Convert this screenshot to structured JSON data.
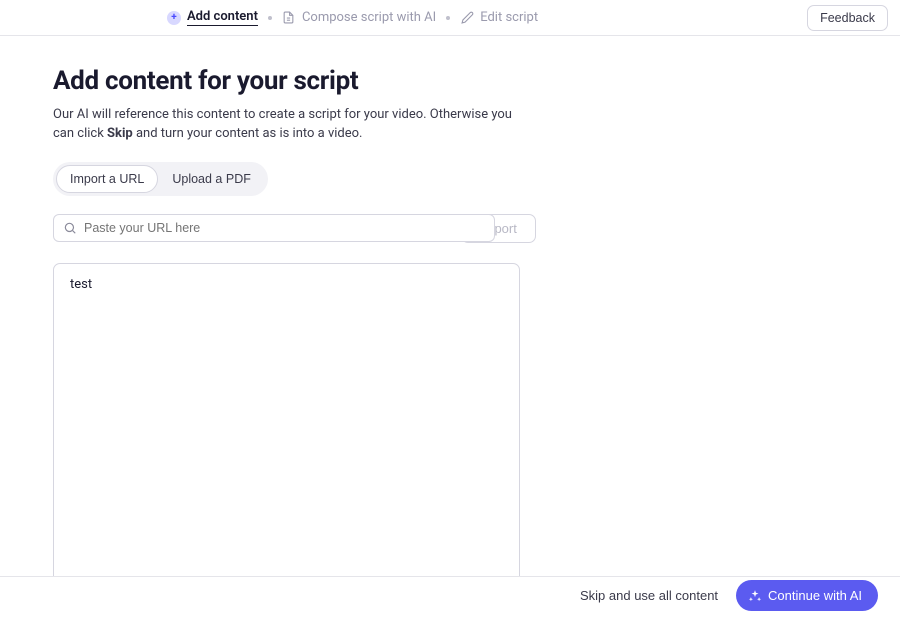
{
  "topbar": {
    "steps": {
      "add": "Add content",
      "compose": "Compose script with AI",
      "edit": "Edit script"
    },
    "feedback": "Feedback"
  },
  "main": {
    "heading": "Add content for your script",
    "desc_before": "Our AI will reference this content to create a script for your video. Otherwise you can click ",
    "desc_bold": "Skip",
    "desc_after": " and turn your content as is into a video.",
    "tabs": {
      "url": "Import a URL",
      "pdf": "Upload a PDF"
    },
    "url_placeholder": "Paste your URL here",
    "url_value": "",
    "import_btn": "Import",
    "content_value": "test"
  },
  "footer": {
    "skip": "Skip and use all content",
    "continue": "Continue with AI"
  }
}
